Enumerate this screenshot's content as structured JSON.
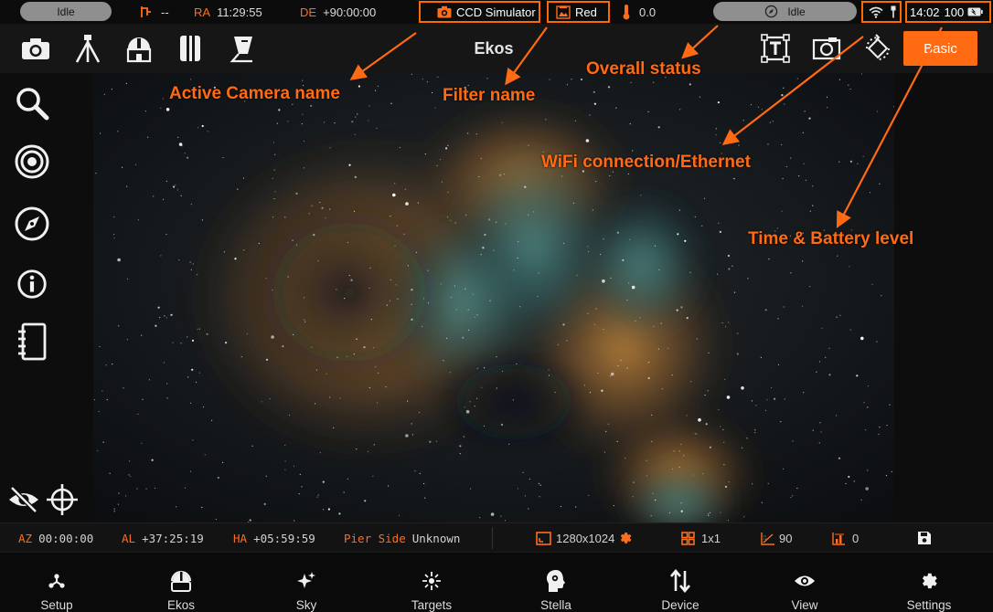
{
  "status_bar": {
    "left_status": "Idle",
    "mount_value": "--",
    "ra_label": "RA",
    "ra_value": "11:29:55",
    "de_label": "DE",
    "de_value": "+90:00:00",
    "camera_name": "CCD Simulator",
    "filter_name": "Red",
    "temperature": "0.0",
    "overall_status": "Idle",
    "time": "14:02",
    "battery": "100"
  },
  "toolbar": {
    "title": "Ekos",
    "basic_label": "Basic"
  },
  "info_bar": {
    "az_label": "AZ",
    "az_value": "00:00:00",
    "al_label": "AL",
    "al_value": "+37:25:19",
    "ha_label": "HA",
    "ha_value": "+05:59:59",
    "pier_label": "Pier Side",
    "pier_value": "Unknown",
    "resolution": "1280x1024",
    "binning": "1x1",
    "gain": "90",
    "offset": "0"
  },
  "bottom_nav": {
    "items": [
      {
        "label": "Setup",
        "icon": "setup-icon"
      },
      {
        "label": "Ekos",
        "icon": "ekos-icon"
      },
      {
        "label": "Sky",
        "icon": "sky-icon"
      },
      {
        "label": "Targets",
        "icon": "targets-icon"
      },
      {
        "label": "Stella",
        "icon": "stella-icon"
      },
      {
        "label": "Device",
        "icon": "device-icon"
      },
      {
        "label": "View",
        "icon": "view-icon"
      },
      {
        "label": "Settings",
        "icon": "gear-icon"
      }
    ]
  },
  "annotations": {
    "camera": "Active Camera name",
    "filter": "Filter name",
    "overall": "Overall status",
    "wifi": "WiFi connection/Ethernet",
    "time_battery": "Time & Battery level"
  },
  "colors": {
    "accent": "#ff6a13",
    "label_orange": "#ff6d1a",
    "pill_gray": "#8f8f8f",
    "background": "#101010"
  }
}
